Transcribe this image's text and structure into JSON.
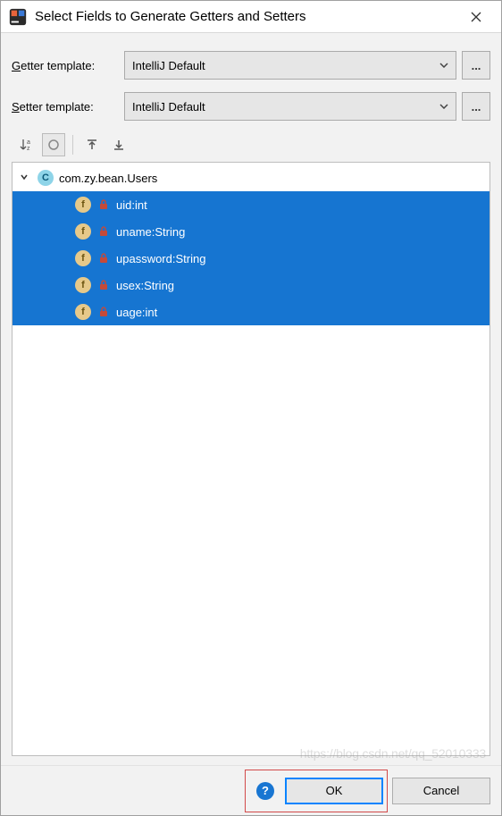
{
  "titlebar": {
    "title": "Select Fields to Generate Getters and Setters"
  },
  "templates": {
    "getter_label": "Getter template:",
    "setter_label": "Setter template:",
    "getter_value": "IntelliJ Default",
    "setter_value": "IntelliJ Default",
    "dots": "..."
  },
  "toolbar": {
    "sort_label": "az"
  },
  "tree": {
    "class_name": "com.zy.bean.Users",
    "fields": [
      {
        "text": "uid:int"
      },
      {
        "text": "uname:String"
      },
      {
        "text": "upassword:String"
      },
      {
        "text": "usex:String"
      },
      {
        "text": "uage:int"
      }
    ]
  },
  "footer": {
    "ok": "OK",
    "cancel": "Cancel",
    "help": "?"
  },
  "watermark": "https://blog.csdn.net/qq_52010333"
}
